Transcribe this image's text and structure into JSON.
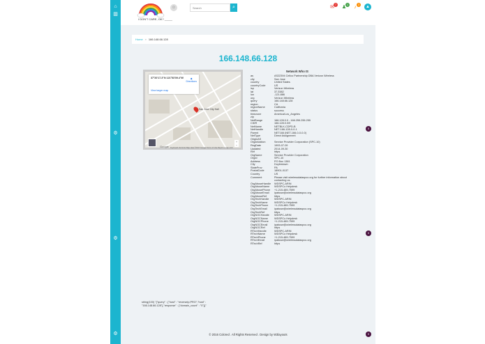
{
  "app": {
    "logo_text": "I DON'T CARE, OK?  _____",
    "search_placeholder": "Search",
    "notif_badges": [
      "7",
      "1",
      "3"
    ]
  },
  "breadcrumb": {
    "home": "Home",
    "current": "166.148.66.128"
  },
  "page_title": "166.148.66.128",
  "map": {
    "coord": "37°20'17.3\"N 121°53'09.4\"W",
    "directions": "Directions",
    "larger_map": "View larger map",
    "pin_label": "San Jose City Hall",
    "google": "Google",
    "attribution": "Keyboard shortcuts  Map data ©2017 Google  Terms of Use  Report a map error"
  },
  "whois": {
    "title": "Network Who IS",
    "rows": [
      [
        "as",
        "AS22394 Cellco Partnership DBA Verizon Wireless"
      ],
      [
        "city",
        "San Jose"
      ],
      [
        "country",
        "United States"
      ],
      [
        "countryCode",
        "US"
      ],
      [
        "isp",
        "Verizon Wireless"
      ],
      [
        "lat",
        "37.3382"
      ],
      [
        "lon",
        "-121.886"
      ],
      [
        "org",
        "Verizon Wireless"
      ],
      [
        "query",
        "166.148.66.128"
      ],
      [
        "region",
        "CA"
      ],
      [
        "regionName",
        "California"
      ],
      [
        "status",
        "success"
      ],
      [
        "timezone",
        "America/Los_Angeles"
      ],
      [
        "zip",
        ""
      ],
      [
        "NetRange",
        "166.128.0.0 - 166.255.255.255"
      ],
      [
        "CIDR",
        "166.128.0.0/9"
      ],
      [
        "NetName",
        "NETBLK-CDPD-B"
      ],
      [
        "NetHandle",
        "NET-166-128-0-0-1"
      ],
      [
        "Parent",
        "NET166 (NET-166-0-0-0-0)"
      ],
      [
        "NetType",
        "Direct Assignment"
      ],
      [
        "OriginAS",
        ""
      ],
      [
        "Organization",
        "Service Provider Corporation (SPC-10)"
      ],
      [
        "RegDate",
        "1993-07-09"
      ],
      [
        "Updated",
        "2014-09-30"
      ],
      [
        "Ref",
        "https"
      ],
      [
        "OrgName",
        "Service Provider Corporation"
      ],
      [
        "OrgId",
        "SPC-10"
      ],
      [
        "Address",
        "PO Box 1381"
      ],
      [
        "City",
        "Doylestown"
      ],
      [
        "StateProv",
        "PA"
      ],
      [
        "PostalCode",
        "18901-0137"
      ],
      [
        "Country",
        "US"
      ],
      [
        "Comment",
        "Please visit wirelessdataspco.org for further information about contacting us."
      ],
      [
        "OrgAbuseHandle",
        "WDSPC-ARIN"
      ],
      [
        "OrgAbuseName",
        "WDSPCo Helpdesk"
      ],
      [
        "OrgAbusePhone",
        "+1-215-489-7599"
      ],
      [
        "OrgAbuseEmail",
        "ipabuse@wirelessdataspco.org"
      ],
      [
        "OrgAbuseRef",
        "https"
      ],
      [
        "OrgTechHandle",
        "WDSPC-ARIN"
      ],
      [
        "OrgTechName",
        "WDSPCo Helpdesk"
      ],
      [
        "OrgTechPhone",
        "+1-215-489-7599"
      ],
      [
        "OrgTechEmail",
        "ipabuse@wirelessdataspco.org"
      ],
      [
        "OrgTechRef",
        "https"
      ],
      [
        "OrgNOCHandle",
        "WDSPC-ARIN"
      ],
      [
        "OrgNOCName",
        "WDSPCo Helpdesk"
      ],
      [
        "OrgNOCPhone",
        "+1-215-489-7599"
      ],
      [
        "OrgNOCEmail",
        "ipabuse@wirelessdataspco.org"
      ],
      [
        "OrgNOCRef",
        "https"
      ],
      [
        "RTechHandle",
        "WDSPC-ARIN"
      ],
      [
        "RTechName",
        "WDSPCo Helpdesk"
      ],
      [
        "RTechPhone",
        "+1-215-489-7599"
      ],
      [
        "RTechEmail",
        "ipabuse@wirelessdataspco.org"
      ],
      [
        "RTechRef",
        "https"
      ]
    ]
  },
  "raw_dump": "string(100) \"{\"query\" : {\"host\" : \"reverseip,PRO\",\"host\" : \"166.148.66.128\"},\"response\" : {\"domain_count\" : \"0\"}}\"",
  "footer": "© 2016 Colored . All Rights Reserved . Design by W3layouts",
  "fab_label": "0",
  "colors": {
    "accent": "#1cb5cf",
    "fab": "#4a1340"
  }
}
